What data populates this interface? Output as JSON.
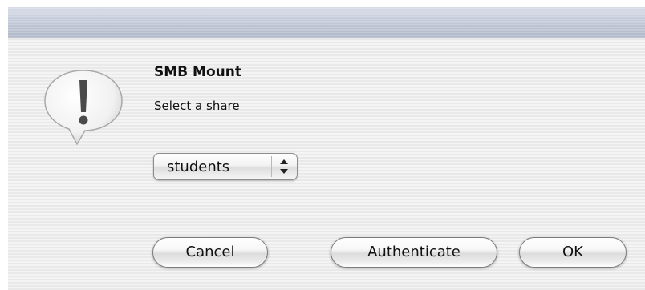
{
  "dialog": {
    "title": "SMB Mount",
    "message": "Select a share",
    "icon": "alert-icon"
  },
  "share_select": {
    "selected": "students",
    "icon": "up-down-arrows-icon"
  },
  "buttons": {
    "cancel": "Cancel",
    "authenticate": "Authenticate",
    "ok": "OK"
  }
}
